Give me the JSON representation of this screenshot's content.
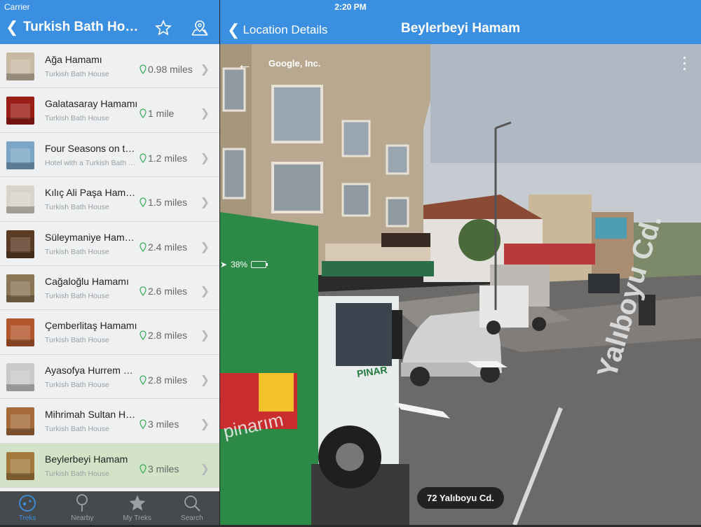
{
  "status_bar": {
    "carrier": "Carrier",
    "time": "2:20 PM",
    "battery": "38%",
    "battery_level": 0.38
  },
  "left_nav": {
    "title": "Turkish Bath House",
    "back_icon": "chevron-left-icon",
    "favorite_icon": "star-icon",
    "map_icon": "map-pin-icon"
  },
  "list": [
    {
      "name": "Ağa Hamamı",
      "subtitle": "Turkish Bath House",
      "distance": "0.98 miles",
      "thumb": "#c8b9a3"
    },
    {
      "name": "Galatasaray Hamamı",
      "subtitle": "Turkish Bath House",
      "distance": "1 mile",
      "thumb": "#9b1d18"
    },
    {
      "name": "Four Seasons on the Bosphorus",
      "subtitle": "Hotel with a Turkish Bath House",
      "distance": "1.2 miles",
      "thumb": "#7aa5c6"
    },
    {
      "name": "Kılıç Ali Paşa Hamamı",
      "subtitle": "Turkish Bath House",
      "distance": "1.5 miles",
      "thumb": "#d9d3c9"
    },
    {
      "name": "Süleymaniye Hamamı",
      "subtitle": "Turkish Bath House",
      "distance": "2.4 miles",
      "thumb": "#5a3a22"
    },
    {
      "name": "Cağaloğlu Hamamı",
      "subtitle": "Turkish Bath House",
      "distance": "2.6 miles",
      "thumb": "#8a7555"
    },
    {
      "name": "Çemberlitaş Hamamı",
      "subtitle": "Turkish Bath House",
      "distance": "2.8 miles",
      "thumb": "#b2562b"
    },
    {
      "name": "Ayasofya Hurrem Sultan Hamamı",
      "subtitle": "Turkish Bath House",
      "distance": "2.8 miles",
      "thumb": "#c9c9c9"
    },
    {
      "name": "Mihrimah Sultan Hamamı",
      "subtitle": "Turkish Bath House",
      "distance": "3 miles",
      "thumb": "#a46a38"
    },
    {
      "name": "Beylerbeyi Hamam",
      "subtitle": "Turkish Bath House",
      "distance": "3 miles",
      "thumb": "#a47a3c",
      "selected": true
    }
  ],
  "tabs": [
    {
      "label": "Treks",
      "icon": "compass-icon",
      "active": true
    },
    {
      "label": "Nearby",
      "icon": "pin-icon",
      "active": false
    },
    {
      "label": "My Treks",
      "icon": "star-icon",
      "active": false
    },
    {
      "label": "Search",
      "icon": "search-icon",
      "active": false
    }
  ],
  "right_nav": {
    "back_label": "Location Details",
    "title": "Beylerbeyi Hamam"
  },
  "street_view": {
    "credit": "Google, Inc.",
    "address": "72 Yalıboyu Cd.",
    "road_label": "Yalıboyu Cd.",
    "truck_brand": "PINAR",
    "truck_slogan": "pinarım"
  },
  "colors": {
    "accent": "#3b8fe0",
    "selected_row": "#d2e3c7",
    "distance_pin": "#3fae5b"
  }
}
